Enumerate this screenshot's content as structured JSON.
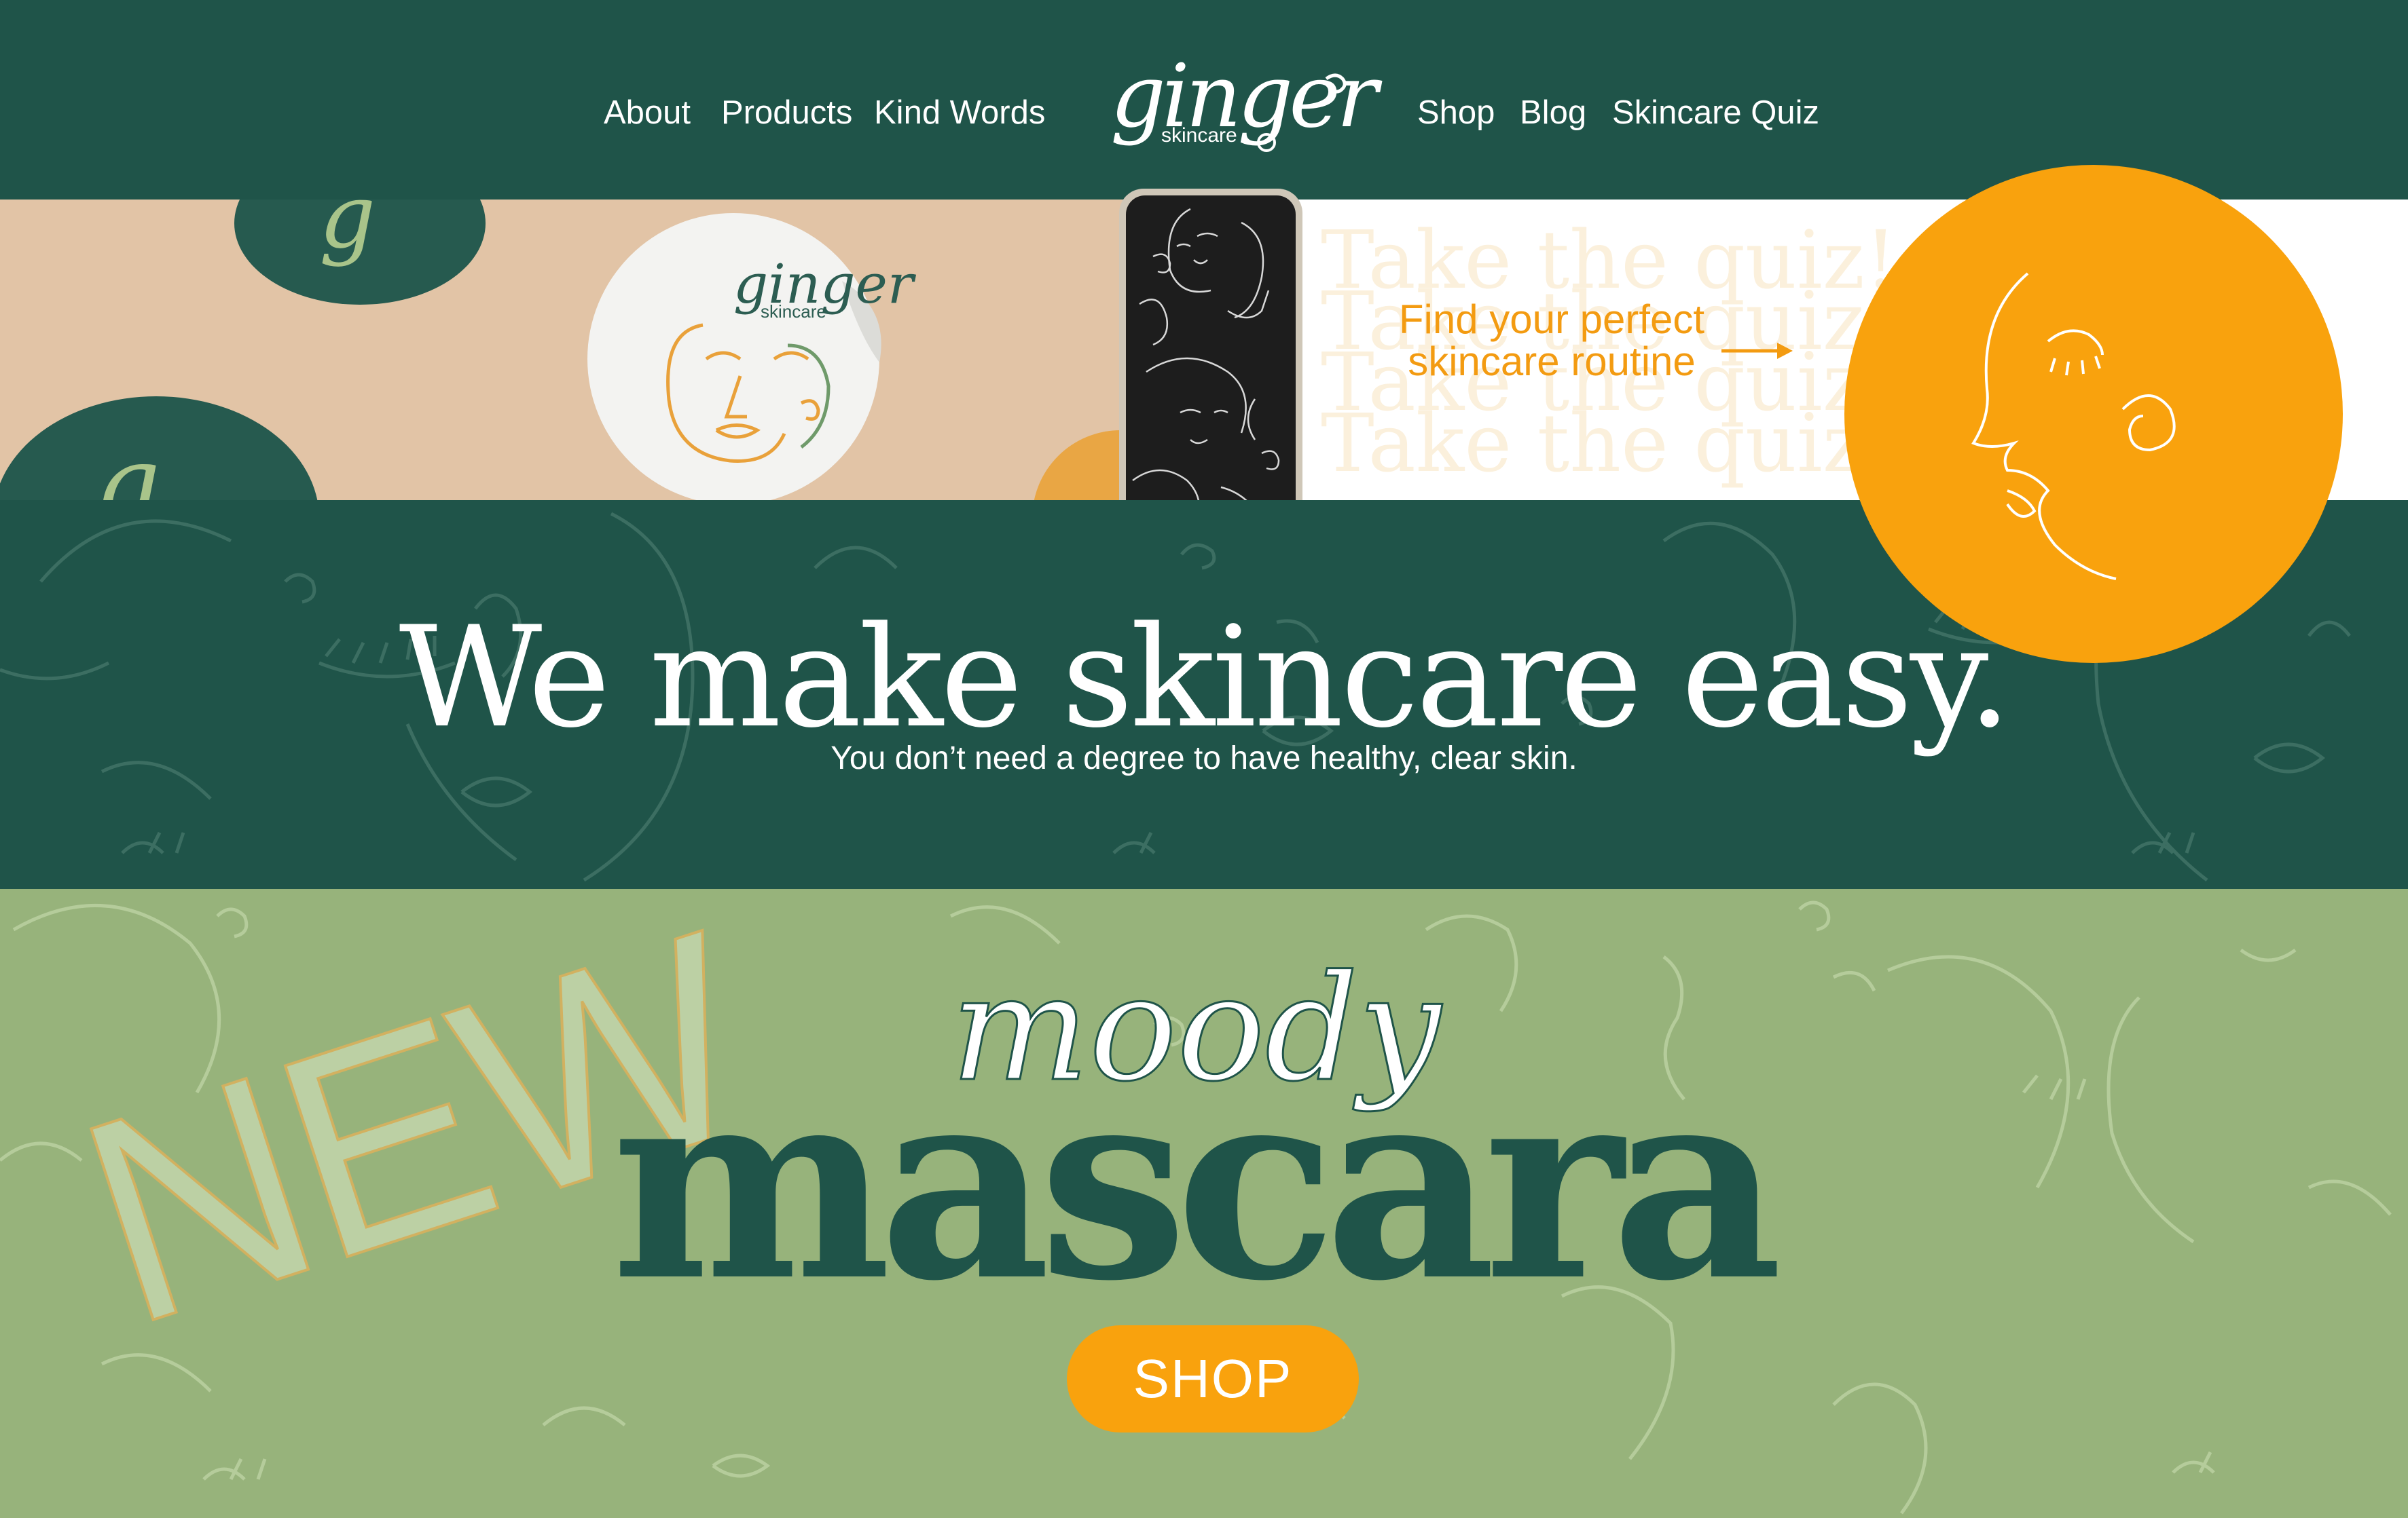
{
  "nav": {
    "left": [
      "About",
      "Products",
      "Kind Words"
    ],
    "right": [
      "Shop",
      "Blog",
      "Skincare Quiz"
    ]
  },
  "logo": {
    "word": "ginger",
    "sub": "skincare"
  },
  "banner": {
    "sticker_logo_word": "ginger",
    "sticker_logo_sub": "skincare",
    "quiz_bg_text": "Take the quiz!",
    "quiz_cta_line1": "Find your perfect",
    "quiz_cta_line2": "skincare routine"
  },
  "hero": {
    "headline": "We make skincare easy.",
    "subhead": "You don’t need a degree to have healthy, clear skin."
  },
  "promo": {
    "new_label": "NEW",
    "moody_label": "moody",
    "mascara_label": "mascara",
    "shop_label": "SHOP"
  },
  "colors": {
    "dark_green": "#1f5449",
    "sage_green": "#97b37b",
    "orange": "#f9a20d",
    "peach": "#e2c4a6",
    "white": "#ffffff"
  }
}
